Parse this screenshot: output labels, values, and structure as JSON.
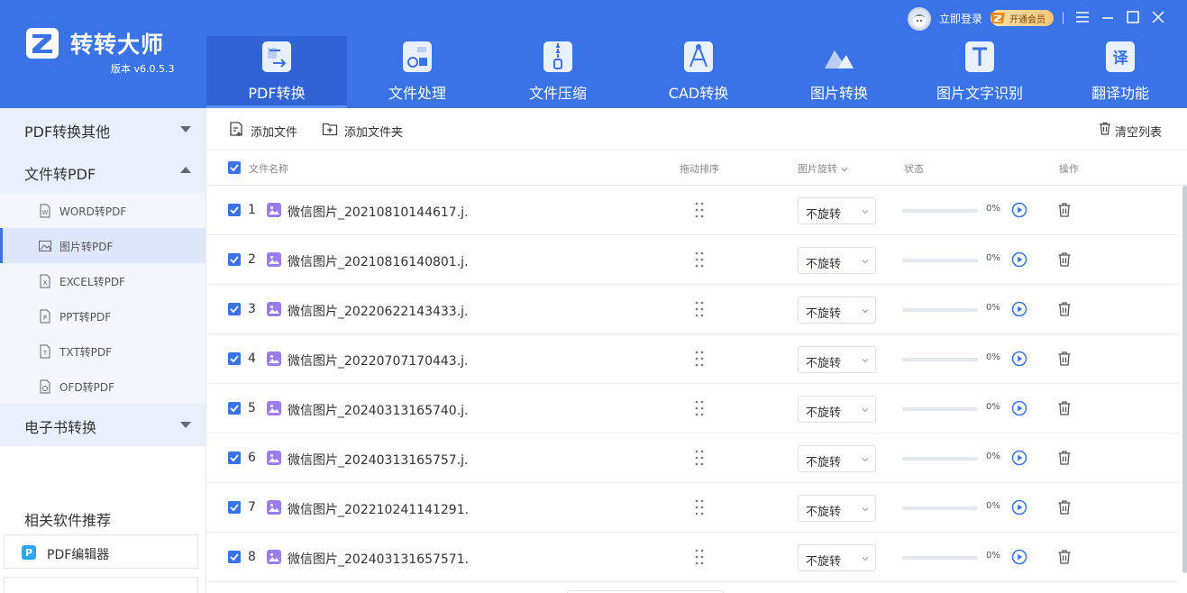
{
  "app": {
    "name": "转转大师",
    "version": "版本 v6.0.5.3",
    "brand_color": "#3a73e8",
    "active_tab_color": "#2f63d6"
  },
  "topbar": {
    "login_label": "立即登录",
    "vip_label": "开通会员"
  },
  "nav": {
    "tabs": [
      {
        "label": "PDF转换",
        "icon": "pdf-convert-icon",
        "active": true
      },
      {
        "label": "文件处理",
        "icon": "file-process-icon",
        "active": false
      },
      {
        "label": "文件压缩",
        "icon": "file-compress-icon",
        "active": false
      },
      {
        "label": "CAD转换",
        "icon": "cad-convert-icon",
        "active": false
      },
      {
        "label": "图片转换",
        "icon": "image-convert-icon",
        "active": false
      },
      {
        "label": "图片文字识别",
        "icon": "image-ocr-icon",
        "active": false
      },
      {
        "label": "翻译功能",
        "icon": "translate-icon",
        "active": false
      }
    ]
  },
  "sidebar": {
    "groups": [
      {
        "label": "PDF转换其他",
        "expanded": false
      },
      {
        "label": "文件转PDF",
        "expanded": true
      },
      {
        "label": "电子书转换",
        "expanded": false
      }
    ],
    "items": [
      {
        "label": "WORD转PDF",
        "icon": "word-file-icon",
        "active": false
      },
      {
        "label": "图片转PDF",
        "icon": "image-file-icon",
        "active": true
      },
      {
        "label": "EXCEL转PDF",
        "icon": "excel-file-icon",
        "active": false
      },
      {
        "label": "PPT转PDF",
        "icon": "ppt-file-icon",
        "active": false
      },
      {
        "label": "TXT转PDF",
        "icon": "txt-file-icon",
        "active": false
      },
      {
        "label": "OFD转PDF",
        "icon": "ofd-file-icon",
        "active": false
      }
    ],
    "recommend_title": "相关软件推荐",
    "recommend": [
      {
        "label": "PDF编辑器",
        "icon": "pdf-editor-icon"
      }
    ]
  },
  "toolbar": {
    "add_file_label": "添加文件",
    "add_folder_label": "添加文件夹",
    "clear_list_label": "清空列表"
  },
  "table": {
    "headers": {
      "name": "文件名称",
      "drag": "拖动排序",
      "rotate": "图片旋转",
      "status": "状态",
      "action": "操作"
    },
    "rows": [
      {
        "index": "1",
        "name": "微信图片_20210810144617.j...",
        "rotate": "不旋转",
        "progress": 0,
        "progress_text": "0%",
        "checked": true
      },
      {
        "index": "2",
        "name": "微信图片_20210816140801.j...",
        "rotate": "不旋转",
        "progress": 0,
        "progress_text": "0%",
        "checked": true
      },
      {
        "index": "3",
        "name": "微信图片_20220622143433.j...",
        "rotate": "不旋转",
        "progress": 0,
        "progress_text": "0%",
        "checked": true
      },
      {
        "index": "4",
        "name": "微信图片_20220707170443.j...",
        "rotate": "不旋转",
        "progress": 0,
        "progress_text": "0%",
        "checked": true
      },
      {
        "index": "5",
        "name": "微信图片_20240313165740.j...",
        "rotate": "不旋转",
        "progress": 0,
        "progress_text": "0%",
        "checked": true
      },
      {
        "index": "6",
        "name": "微信图片_20240313165757.j...",
        "rotate": "不旋转",
        "progress": 0,
        "progress_text": "0%",
        "checked": true
      },
      {
        "index": "7",
        "name": "微信图片_202210241141291....",
        "rotate": "不旋转",
        "progress": 0,
        "progress_text": "0%",
        "checked": true
      },
      {
        "index": "8",
        "name": "微信图片_202403131657571....",
        "rotate": "不旋转",
        "progress": 0,
        "progress_text": "0%",
        "checked": true
      }
    ]
  }
}
